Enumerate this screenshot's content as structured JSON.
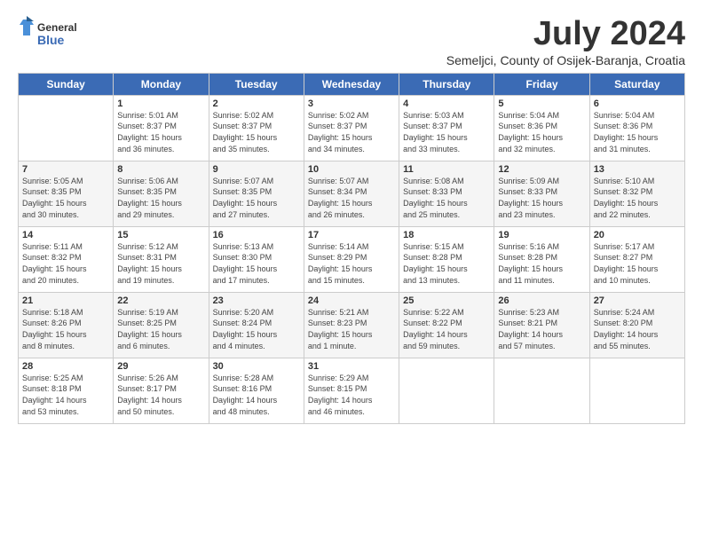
{
  "header": {
    "logo_line1": "General",
    "logo_line2": "Blue",
    "title": "July 2024",
    "location": "Semeljci, County of Osijek-Baranja, Croatia"
  },
  "days_of_week": [
    "Sunday",
    "Monday",
    "Tuesday",
    "Wednesday",
    "Thursday",
    "Friday",
    "Saturday"
  ],
  "weeks": [
    [
      {
        "day": "",
        "info": ""
      },
      {
        "day": "1",
        "info": "Sunrise: 5:01 AM\nSunset: 8:37 PM\nDaylight: 15 hours\nand 36 minutes."
      },
      {
        "day": "2",
        "info": "Sunrise: 5:02 AM\nSunset: 8:37 PM\nDaylight: 15 hours\nand 35 minutes."
      },
      {
        "day": "3",
        "info": "Sunrise: 5:02 AM\nSunset: 8:37 PM\nDaylight: 15 hours\nand 34 minutes."
      },
      {
        "day": "4",
        "info": "Sunrise: 5:03 AM\nSunset: 8:37 PM\nDaylight: 15 hours\nand 33 minutes."
      },
      {
        "day": "5",
        "info": "Sunrise: 5:04 AM\nSunset: 8:36 PM\nDaylight: 15 hours\nand 32 minutes."
      },
      {
        "day": "6",
        "info": "Sunrise: 5:04 AM\nSunset: 8:36 PM\nDaylight: 15 hours\nand 31 minutes."
      }
    ],
    [
      {
        "day": "7",
        "info": "Sunrise: 5:05 AM\nSunset: 8:35 PM\nDaylight: 15 hours\nand 30 minutes."
      },
      {
        "day": "8",
        "info": "Sunrise: 5:06 AM\nSunset: 8:35 PM\nDaylight: 15 hours\nand 29 minutes."
      },
      {
        "day": "9",
        "info": "Sunrise: 5:07 AM\nSunset: 8:35 PM\nDaylight: 15 hours\nand 27 minutes."
      },
      {
        "day": "10",
        "info": "Sunrise: 5:07 AM\nSunset: 8:34 PM\nDaylight: 15 hours\nand 26 minutes."
      },
      {
        "day": "11",
        "info": "Sunrise: 5:08 AM\nSunset: 8:33 PM\nDaylight: 15 hours\nand 25 minutes."
      },
      {
        "day": "12",
        "info": "Sunrise: 5:09 AM\nSunset: 8:33 PM\nDaylight: 15 hours\nand 23 minutes."
      },
      {
        "day": "13",
        "info": "Sunrise: 5:10 AM\nSunset: 8:32 PM\nDaylight: 15 hours\nand 22 minutes."
      }
    ],
    [
      {
        "day": "14",
        "info": "Sunrise: 5:11 AM\nSunset: 8:32 PM\nDaylight: 15 hours\nand 20 minutes."
      },
      {
        "day": "15",
        "info": "Sunrise: 5:12 AM\nSunset: 8:31 PM\nDaylight: 15 hours\nand 19 minutes."
      },
      {
        "day": "16",
        "info": "Sunrise: 5:13 AM\nSunset: 8:30 PM\nDaylight: 15 hours\nand 17 minutes."
      },
      {
        "day": "17",
        "info": "Sunrise: 5:14 AM\nSunset: 8:29 PM\nDaylight: 15 hours\nand 15 minutes."
      },
      {
        "day": "18",
        "info": "Sunrise: 5:15 AM\nSunset: 8:28 PM\nDaylight: 15 hours\nand 13 minutes."
      },
      {
        "day": "19",
        "info": "Sunrise: 5:16 AM\nSunset: 8:28 PM\nDaylight: 15 hours\nand 11 minutes."
      },
      {
        "day": "20",
        "info": "Sunrise: 5:17 AM\nSunset: 8:27 PM\nDaylight: 15 hours\nand 10 minutes."
      }
    ],
    [
      {
        "day": "21",
        "info": "Sunrise: 5:18 AM\nSunset: 8:26 PM\nDaylight: 15 hours\nand 8 minutes."
      },
      {
        "day": "22",
        "info": "Sunrise: 5:19 AM\nSunset: 8:25 PM\nDaylight: 15 hours\nand 6 minutes."
      },
      {
        "day": "23",
        "info": "Sunrise: 5:20 AM\nSunset: 8:24 PM\nDaylight: 15 hours\nand 4 minutes."
      },
      {
        "day": "24",
        "info": "Sunrise: 5:21 AM\nSunset: 8:23 PM\nDaylight: 15 hours\nand 1 minute."
      },
      {
        "day": "25",
        "info": "Sunrise: 5:22 AM\nSunset: 8:22 PM\nDaylight: 14 hours\nand 59 minutes."
      },
      {
        "day": "26",
        "info": "Sunrise: 5:23 AM\nSunset: 8:21 PM\nDaylight: 14 hours\nand 57 minutes."
      },
      {
        "day": "27",
        "info": "Sunrise: 5:24 AM\nSunset: 8:20 PM\nDaylight: 14 hours\nand 55 minutes."
      }
    ],
    [
      {
        "day": "28",
        "info": "Sunrise: 5:25 AM\nSunset: 8:18 PM\nDaylight: 14 hours\nand 53 minutes."
      },
      {
        "day": "29",
        "info": "Sunrise: 5:26 AM\nSunset: 8:17 PM\nDaylight: 14 hours\nand 50 minutes."
      },
      {
        "day": "30",
        "info": "Sunrise: 5:28 AM\nSunset: 8:16 PM\nDaylight: 14 hours\nand 48 minutes."
      },
      {
        "day": "31",
        "info": "Sunrise: 5:29 AM\nSunset: 8:15 PM\nDaylight: 14 hours\nand 46 minutes."
      },
      {
        "day": "",
        "info": ""
      },
      {
        "day": "",
        "info": ""
      },
      {
        "day": "",
        "info": ""
      }
    ]
  ]
}
